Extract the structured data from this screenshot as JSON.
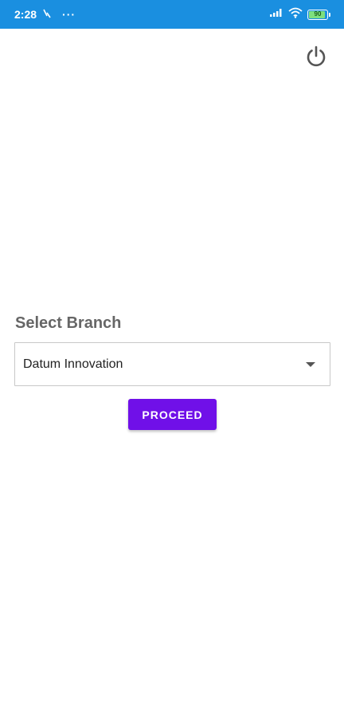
{
  "status_bar": {
    "time": "2:28",
    "notification_icon": "signal-activity-icon",
    "overflow_dots": "···",
    "signal_icon": "cellular-signal-icon",
    "wifi_icon": "wifi-icon",
    "battery_level": "90",
    "background_color": "#1a8fe0"
  },
  "header": {
    "power_icon": "power-icon"
  },
  "branch": {
    "label": "Select Branch",
    "selected_value": "Datum Innovation"
  },
  "actions": {
    "proceed_label": "PROCEED",
    "accent_color": "#7010e8"
  }
}
